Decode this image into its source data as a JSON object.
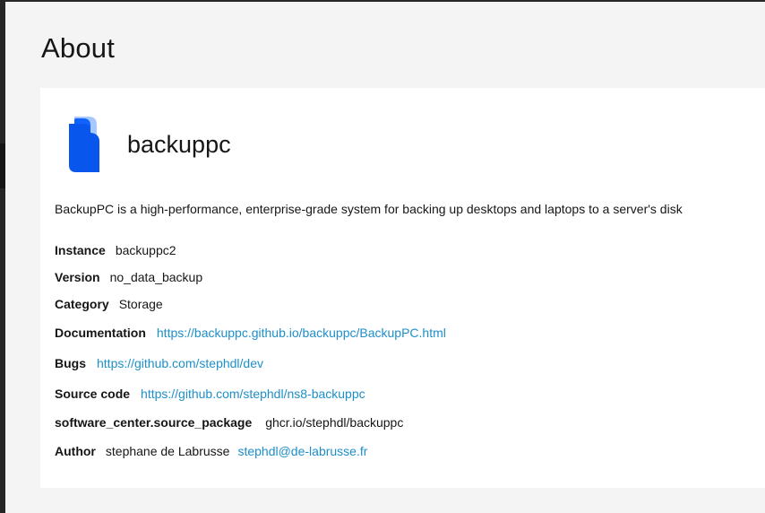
{
  "page": {
    "title": "About"
  },
  "app": {
    "name": "backuppc",
    "logo_icon": "backuppc-logo-icon",
    "description": "BackupPC is a high-performance, enterprise-grade system for backing up desktops and laptops to a server's disk"
  },
  "info": {
    "instance": {
      "label": "Instance",
      "value": "backuppc2"
    },
    "version": {
      "label": "Version",
      "value": "no_data_backup"
    },
    "category": {
      "label": "Category",
      "value": "Storage"
    },
    "documentation": {
      "label": "Documentation",
      "link": "https://backuppc.github.io/backuppc/BackupPC.html"
    },
    "bugs": {
      "label": "Bugs",
      "link": "https://github.com/stephdl/dev"
    },
    "source_code": {
      "label": "Source code",
      "link": "https://github.com/stephdl/ns8-backuppc"
    },
    "source_package": {
      "label": "software_center.source_package",
      "value": "ghcr.io/stephdl/backuppc"
    },
    "author": {
      "label": "Author",
      "value": "stephane de Labrusse",
      "email": "stephdl@de-labrusse.fr"
    }
  },
  "colors": {
    "link": "#1d8fc9",
    "logo_front": "#0f62fe",
    "logo_back": "#a6c8ff"
  }
}
